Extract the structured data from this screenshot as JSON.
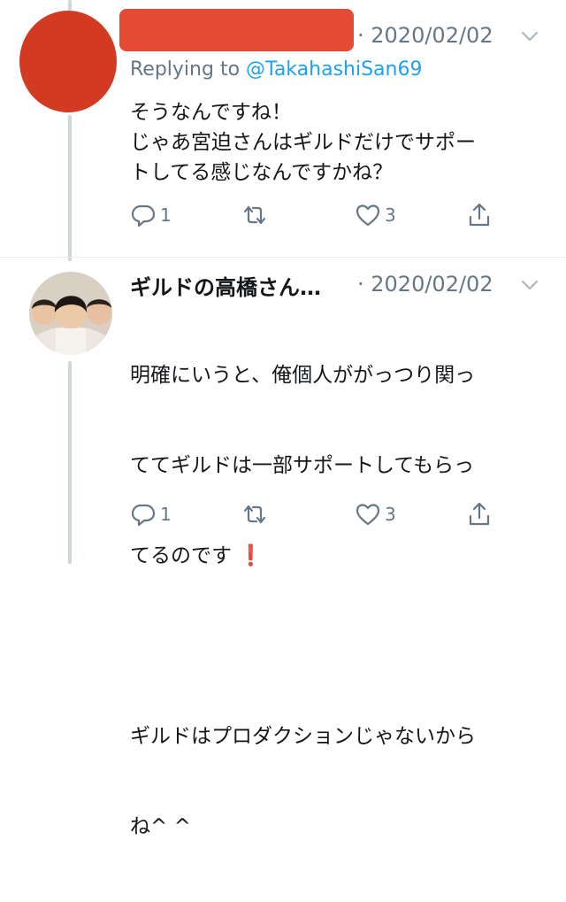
{
  "tweet1": {
    "timestamp": "· 2020/02/02",
    "replying_prefix": "Replying to ",
    "replying_handle": "@TakahashiSan69",
    "body": "そうなんですね！\nじゃあ宮迫さんはギルドだけでサポー\nトしてる感じなんですかね？",
    "reply_count": "1",
    "retweet_count": "",
    "like_count": "3"
  },
  "tweet2": {
    "display_name": "ギルドの高橋さん…",
    "timestamp": "· 2020/02/02",
    "body_line1": "明確にいうと、俺個人ががっつり関っ",
    "body_line2": "ててギルドは一部サポートしてもらっ",
    "body_line3": "てるのです",
    "body_emoji": "❗",
    "body_line5": "ギルドはプロダクションじゃないから",
    "body_line6": "ね^ ^",
    "reply_count": "1",
    "retweet_count": "",
    "like_count": "3"
  },
  "icons": [
    "chevron-down-icon",
    "reply-icon",
    "retweet-icon",
    "like-icon",
    "share-icon"
  ],
  "colors": {
    "text": "#14171a",
    "secondary": "#657786",
    "link": "#1da1f2",
    "thread": "#ccd6dd",
    "redaction": "#e2412a"
  }
}
